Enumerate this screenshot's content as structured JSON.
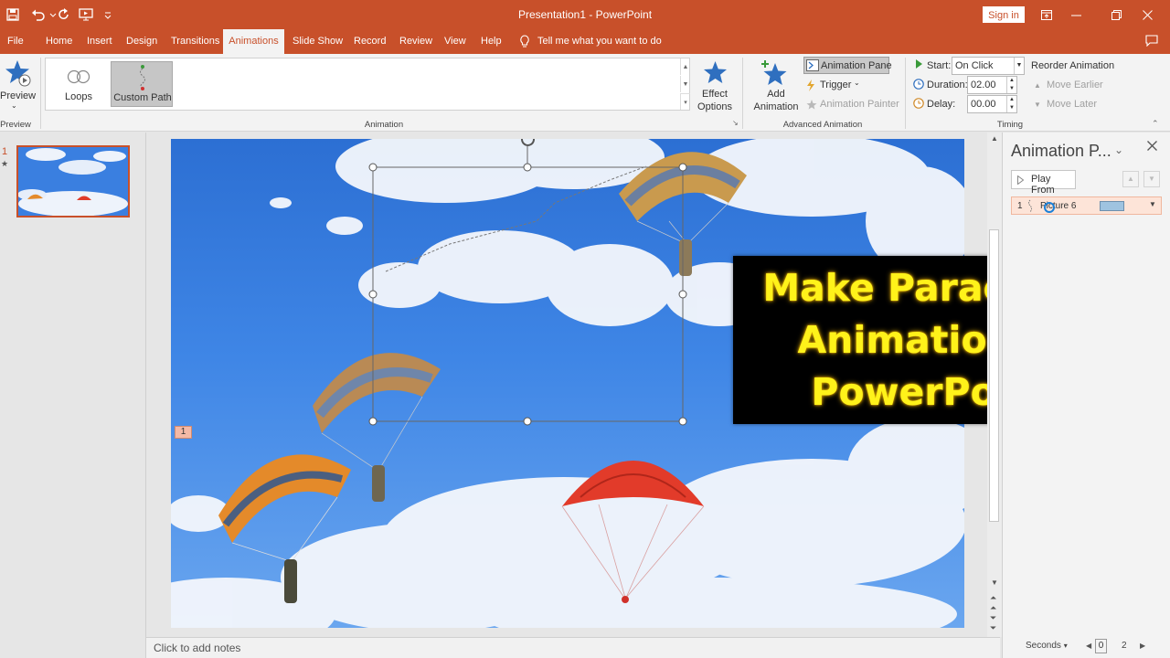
{
  "window": {
    "title": "Presentation1  -  PowerPoint",
    "sign_in": "Sign in"
  },
  "tabs": [
    {
      "label": "File"
    },
    {
      "label": "Home"
    },
    {
      "label": "Insert"
    },
    {
      "label": "Design"
    },
    {
      "label": "Transitions"
    },
    {
      "label": "Animations",
      "active": true
    },
    {
      "label": "Slide Show"
    },
    {
      "label": "Record"
    },
    {
      "label": "Review"
    },
    {
      "label": "View"
    },
    {
      "label": "Help"
    }
  ],
  "tell_me": "Tell me what you want to do",
  "ribbon": {
    "preview": {
      "label": "Preview",
      "group": "Preview"
    },
    "animation_group": "Animation",
    "gallery": [
      {
        "label": "Loops",
        "icon": "loops-path-icon"
      },
      {
        "label": "Custom Path",
        "icon": "custom-path-icon",
        "selected": true
      }
    ],
    "effect_options": {
      "line1": "Effect",
      "line2": "Options"
    },
    "advanced": {
      "group": "Advanced Animation",
      "add_animation_line1": "Add",
      "add_animation_line2": "Animation",
      "animation_pane": "Animation Pane",
      "trigger": "Trigger",
      "animation_painter": "Animation Painter"
    },
    "timing": {
      "group": "Timing",
      "start_label": "Start:",
      "start_value": "On Click",
      "duration_label": "Duration:",
      "duration_value": "02.00",
      "delay_label": "Delay:",
      "delay_value": "00.00",
      "reorder": "Reorder Animation",
      "move_earlier": "Move Earlier",
      "move_later": "Move Later"
    }
  },
  "thumbnails": {
    "number": "1",
    "star": "★"
  },
  "slide": {
    "anim_tag": "1",
    "banner_lines": [
      "Make Parachute",
      "Animation In",
      "PowerPoint"
    ]
  },
  "notes": {
    "placeholder": "Click to add notes"
  },
  "animation_pane": {
    "title": "Animation P...",
    "play_from": "Play From",
    "item_number": "1",
    "item_name": "Picture 6",
    "seconds": "Seconds",
    "timeline_start": "0",
    "timeline_mid": "2"
  },
  "colors": {
    "accent": "#c8502a",
    "banner_text": "#fff21a"
  }
}
